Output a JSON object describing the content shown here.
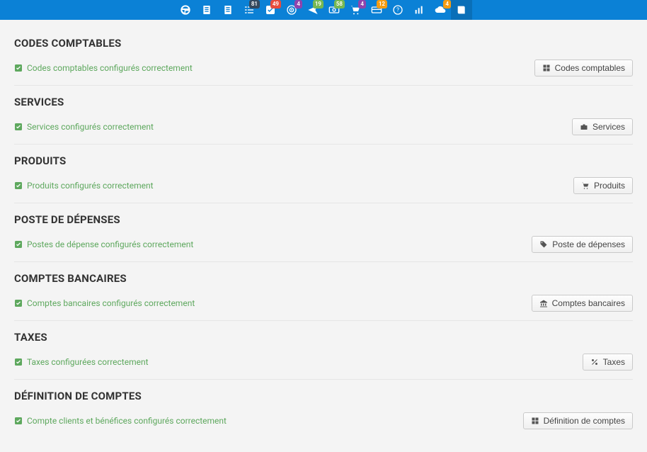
{
  "topbar": {
    "badges": {
      "list": "81",
      "check": "49",
      "target": "4",
      "send": "19",
      "pay": "58",
      "cart": "4",
      "card": "12",
      "cloud": "4"
    }
  },
  "sections": [
    {
      "title": "CODES COMPTABLES",
      "status": "Codes comptables configurés correctement",
      "button": "Codes comptables",
      "icon": "grid"
    },
    {
      "title": "SERVICES",
      "status": "Services configurés correctement",
      "button": "Services",
      "icon": "briefcase"
    },
    {
      "title": "PRODUITS",
      "status": "Produits configurés correctement",
      "button": "Produits",
      "icon": "cart"
    },
    {
      "title": "POSTE DE DÉPENSES",
      "status": "Postes de dépense configurés correctement",
      "button": "Poste de dépenses",
      "icon": "tag"
    },
    {
      "title": "COMPTES BANCAIRES",
      "status": "Comptes bancaires configurés correctement",
      "button": "Comptes bancaires",
      "icon": "bank"
    },
    {
      "title": "TAXES",
      "status": "Taxes configurées correctement",
      "button": "Taxes",
      "icon": "percent"
    },
    {
      "title": "DÉFINITION DE COMPTES",
      "status": "Compte clients et bénéfices configurés correctement",
      "button": "Définition de comptes",
      "icon": "grid"
    }
  ]
}
